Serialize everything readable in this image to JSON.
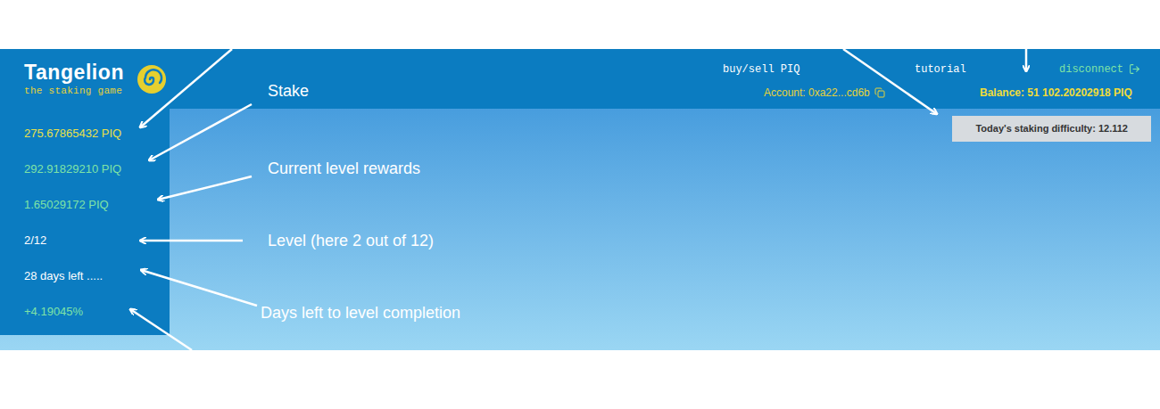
{
  "logo": {
    "title": "Tangelion",
    "subtitle": "the staking game"
  },
  "header": {
    "links": [
      "buy/sell PIQ",
      "tutorial"
    ],
    "account": "Account: 0xa22...cd6b",
    "disconnect": "disconnect",
    "balance": "Balance: 51 102.20202918 PIQ"
  },
  "difficulty": "Today's staking difficulty: 12.112",
  "sidebar": {
    "items": [
      {
        "text": "275.67865432 PIQ",
        "color": "#e8e04a"
      },
      {
        "text": "292.91829210 PIQ",
        "color": "#7fe3a6"
      },
      {
        "text": "1.65029172 PIQ",
        "color": "#7fe3a6"
      },
      {
        "text": "2/12",
        "color": "#ffffff"
      },
      {
        "text": "28 days left .....",
        "color": "#ffffff"
      },
      {
        "text": "+4.19045%",
        "color": "#7fe3a6"
      }
    ]
  },
  "annotations": [
    {
      "label": "Stake"
    },
    {
      "label": "Current level rewards"
    },
    {
      "label": "Level (here 2 out of 12)"
    },
    {
      "label": "Days left to level completion"
    }
  ]
}
